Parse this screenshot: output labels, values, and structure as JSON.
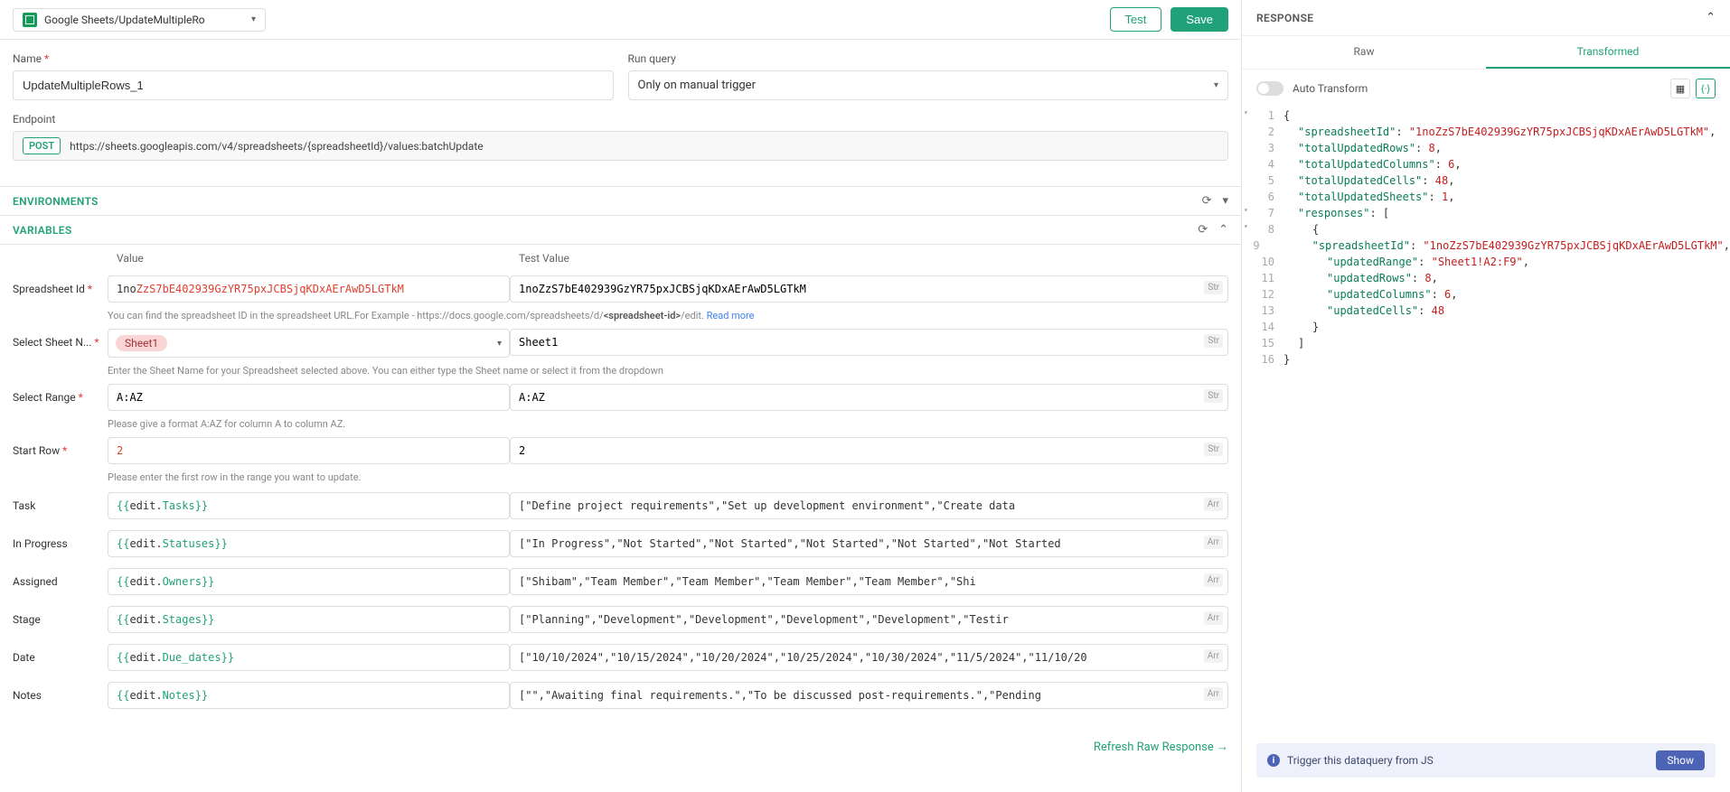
{
  "header": {
    "selector_label": "Google Sheets/UpdateMultipleRo",
    "test_btn": "Test",
    "save_btn": "Save"
  },
  "form": {
    "name_label": "Name",
    "name_value": "UpdateMultipleRows_1",
    "run_query_label": "Run query",
    "run_query_value": "Only on manual trigger",
    "endpoint_label": "Endpoint",
    "endpoint_method": "POST",
    "endpoint_url": "https://sheets.googleapis.com/v4/spreadsheets/{spreadsheetId}/values:batchUpdate"
  },
  "sections": {
    "environments": "ENVIRONMENTS",
    "variables": "VARIABLES"
  },
  "varheaders": {
    "value": "Value",
    "test_value": "Test Value"
  },
  "refresh_label": "Refresh Raw Response  →",
  "vars": {
    "spreadsheet": {
      "label": "Spreadsheet Id",
      "value_black": "1no",
      "value_red": "ZzS7bE402939GzYR75pxJCBSjqKDxAErAwD5LGTkM",
      "test": "1noZzS7bE402939GzYR75pxJCBSjqKDxAErAwD5LGTkM",
      "type": "Str",
      "help_a": "You can find the spreadsheet ID in the spreadsheet URL.For Example - https://docs.google.com/spreadsheets/d/",
      "help_b": "<spreadsheet-id>",
      "help_c": "/edit. ",
      "help_link": "Read more"
    },
    "sheet": {
      "label": "Select Sheet N...",
      "chip": "Sheet1",
      "test": "Sheet1",
      "type": "Str",
      "help": "Enter the Sheet Name for your Spreadsheet selected above. You can either type the Sheet name or select it from the dropdown"
    },
    "range": {
      "label": "Select Range",
      "value": "A:AZ",
      "test": "A:AZ",
      "type": "Str",
      "help": "Please give a format A:AZ for column A to column AZ."
    },
    "startrow": {
      "label": "Start Row",
      "value": "2",
      "test": "2",
      "type": "Str",
      "help": "Please enter the first row in the range you want to update."
    },
    "task": {
      "label": "Task",
      "expr": "Tasks",
      "test": "[\"Define project requirements\",\"Set up development environment\",\"Create data",
      "type": "Arr"
    },
    "inprogress": {
      "label": "In Progress",
      "expr": "Statuses",
      "test": "[\"In Progress\",\"Not Started\",\"Not Started\",\"Not Started\",\"Not Started\",\"Not Started",
      "type": "Arr"
    },
    "assigned": {
      "label": "Assigned",
      "expr": "Owners",
      "test": "[\"Shibam\",\"Team Member\",\"Team Member\",\"Team Member\",\"Team Member\",\"Shi",
      "type": "Arr"
    },
    "stage": {
      "label": "Stage",
      "expr": "Stages",
      "test": "[\"Planning\",\"Development\",\"Development\",\"Development\",\"Development\",\"Testir",
      "type": "Arr"
    },
    "date": {
      "label": "Date",
      "expr": "Due_dates",
      "test": "[\"10/10/2024\",\"10/15/2024\",\"10/20/2024\",\"10/25/2024\",\"10/30/2024\",\"11/5/2024\",\"11/10/20",
      "type": "Arr"
    },
    "notes": {
      "label": "Notes",
      "expr": "Notes",
      "test": "[\"\",\"Awaiting final requirements.\",\"To be discussed post-requirements.\",\"Pending",
      "type": "Arr"
    }
  },
  "response": {
    "title": "RESPONSE",
    "tab_raw": "Raw",
    "tab_transformed": "Transformed",
    "auto_transform": "Auto Transform",
    "trigger_text": "Trigger this dataquery from JS",
    "show_btn": "Show"
  },
  "chart_data": {
    "type": "table",
    "note": "JSON response displayed in code viewer",
    "json": {
      "spreadsheetId": "1noZzS7bE402939GzYR75pxJCBSjqKDxAErAwD5LGTkM",
      "totalUpdatedRows": 8,
      "totalUpdatedColumns": 6,
      "totalUpdatedCells": 48,
      "totalUpdatedSheets": 1,
      "responses": [
        {
          "spreadsheetId": "1noZzS7bE402939GzYR75pxJCBSjqKDxAErAwD5LGTkM",
          "updatedRange": "Sheet1!A2:F9",
          "updatedRows": 8,
          "updatedColumns": 6,
          "updatedCells": 48
        }
      ]
    }
  },
  "code_lines": [
    {
      "n": 1,
      "fold": "▾",
      "indent": 0,
      "tokens": [
        {
          "t": "pun",
          "v": "{"
        }
      ]
    },
    {
      "n": 2,
      "indent": 1,
      "tokens": [
        {
          "t": "key",
          "v": "\"spreadsheetId\""
        },
        {
          "t": "pun",
          "v": ": "
        },
        {
          "t": "str",
          "v": "\"1noZzS7bE402939GzYR75pxJCBSjqKDxAErAwD5LGTkM\""
        },
        {
          "t": "pun",
          "v": ","
        }
      ]
    },
    {
      "n": 3,
      "indent": 1,
      "tokens": [
        {
          "t": "key",
          "v": "\"totalUpdatedRows\""
        },
        {
          "t": "pun",
          "v": ": "
        },
        {
          "t": "num",
          "v": "8"
        },
        {
          "t": "pun",
          "v": ","
        }
      ]
    },
    {
      "n": 4,
      "indent": 1,
      "tokens": [
        {
          "t": "key",
          "v": "\"totalUpdatedColumns\""
        },
        {
          "t": "pun",
          "v": ": "
        },
        {
          "t": "num",
          "v": "6"
        },
        {
          "t": "pun",
          "v": ","
        }
      ]
    },
    {
      "n": 5,
      "indent": 1,
      "tokens": [
        {
          "t": "key",
          "v": "\"totalUpdatedCells\""
        },
        {
          "t": "pun",
          "v": ": "
        },
        {
          "t": "num",
          "v": "48"
        },
        {
          "t": "pun",
          "v": ","
        }
      ]
    },
    {
      "n": 6,
      "indent": 1,
      "tokens": [
        {
          "t": "key",
          "v": "\"totalUpdatedSheets\""
        },
        {
          "t": "pun",
          "v": ": "
        },
        {
          "t": "num",
          "v": "1"
        },
        {
          "t": "pun",
          "v": ","
        }
      ]
    },
    {
      "n": 7,
      "fold": "▾",
      "indent": 1,
      "tokens": [
        {
          "t": "key",
          "v": "\"responses\""
        },
        {
          "t": "pun",
          "v": ": ["
        }
      ]
    },
    {
      "n": 8,
      "fold": "▾",
      "indent": 2,
      "tokens": [
        {
          "t": "pun",
          "v": "{"
        }
      ]
    },
    {
      "n": 9,
      "indent": 3,
      "tokens": [
        {
          "t": "key",
          "v": "\"spreadsheetId\""
        },
        {
          "t": "pun",
          "v": ": "
        },
        {
          "t": "str",
          "v": "\"1noZzS7bE402939GzYR75pxJCBSjqKDxAErAwD5LGTkM\""
        },
        {
          "t": "pun",
          "v": ","
        }
      ]
    },
    {
      "n": 10,
      "indent": 3,
      "tokens": [
        {
          "t": "key",
          "v": "\"updatedRange\""
        },
        {
          "t": "pun",
          "v": ": "
        },
        {
          "t": "str",
          "v": "\"Sheet1!A2:F9\""
        },
        {
          "t": "pun",
          "v": ","
        }
      ]
    },
    {
      "n": 11,
      "indent": 3,
      "tokens": [
        {
          "t": "key",
          "v": "\"updatedRows\""
        },
        {
          "t": "pun",
          "v": ": "
        },
        {
          "t": "num",
          "v": "8"
        },
        {
          "t": "pun",
          "v": ","
        }
      ]
    },
    {
      "n": 12,
      "indent": 3,
      "tokens": [
        {
          "t": "key",
          "v": "\"updatedColumns\""
        },
        {
          "t": "pun",
          "v": ": "
        },
        {
          "t": "num",
          "v": "6"
        },
        {
          "t": "pun",
          "v": ","
        }
      ]
    },
    {
      "n": 13,
      "indent": 3,
      "tokens": [
        {
          "t": "key",
          "v": "\"updatedCells\""
        },
        {
          "t": "pun",
          "v": ": "
        },
        {
          "t": "num",
          "v": "48"
        }
      ]
    },
    {
      "n": 14,
      "indent": 2,
      "tokens": [
        {
          "t": "pun",
          "v": "}"
        }
      ]
    },
    {
      "n": 15,
      "indent": 1,
      "tokens": [
        {
          "t": "pun",
          "v": "]"
        }
      ]
    },
    {
      "n": 16,
      "indent": 0,
      "tokens": [
        {
          "t": "pun",
          "v": "}"
        }
      ]
    }
  ]
}
